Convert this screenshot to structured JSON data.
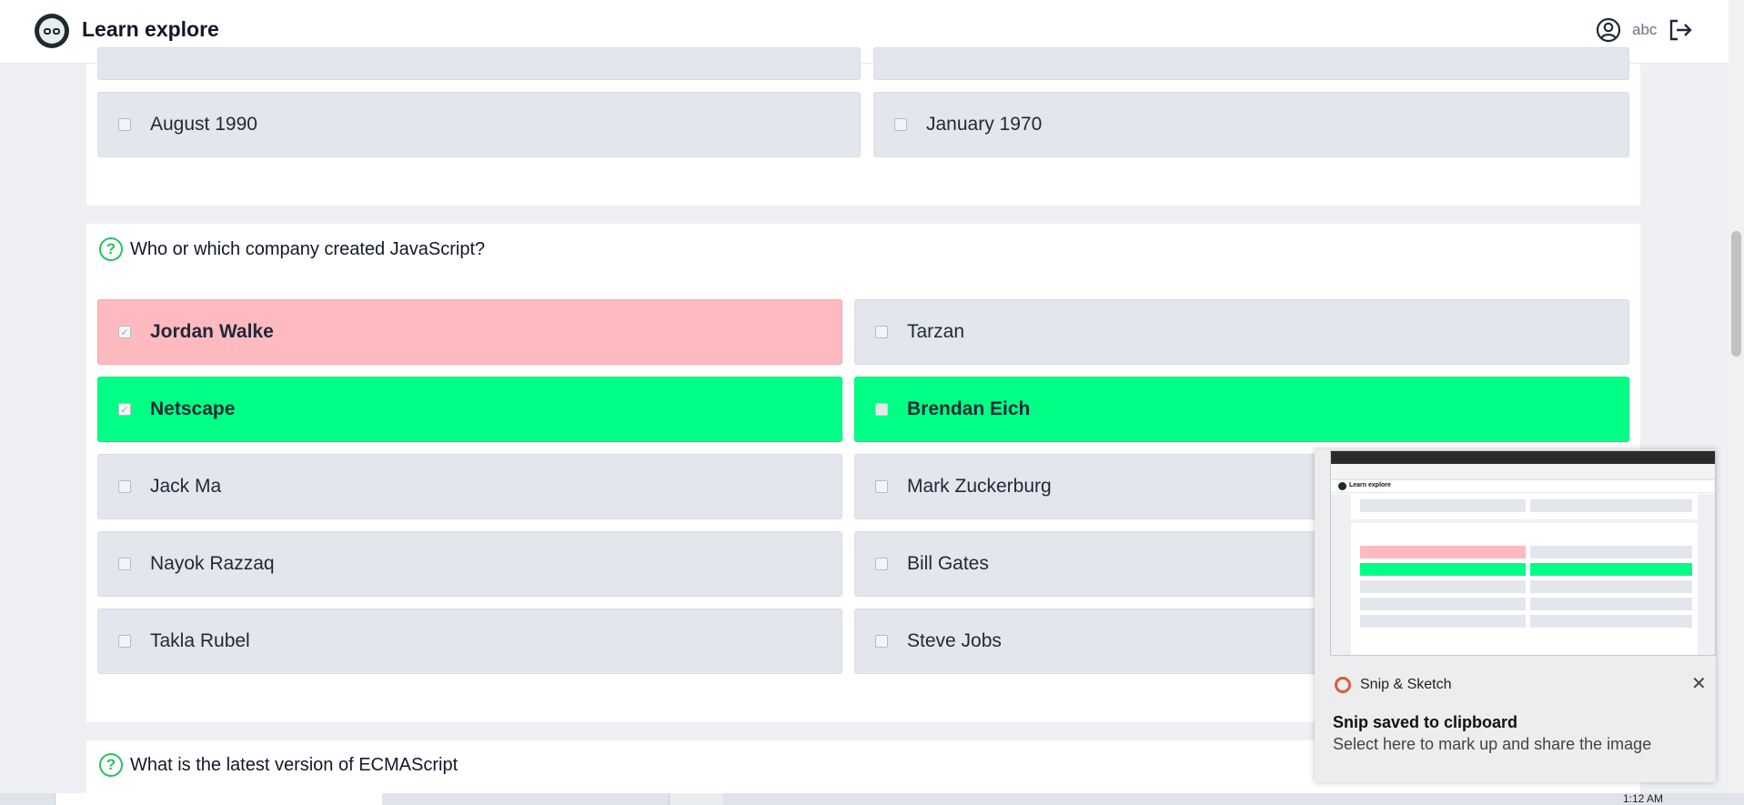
{
  "header": {
    "app_title": "Learn explore",
    "user_name": "abc"
  },
  "prev_question": {
    "options": [
      {
        "label": "August 1990",
        "state": "normal"
      },
      {
        "label": "January 1970",
        "state": "normal"
      }
    ]
  },
  "question": {
    "title": "Who or which company created JavaScript?",
    "options": [
      {
        "label": "Jordan Walke",
        "state": "wrong",
        "checked": true
      },
      {
        "label": "Tarzan",
        "state": "normal",
        "checked": false
      },
      {
        "label": "Netscape",
        "state": "correct",
        "checked": true
      },
      {
        "label": "Brendan Eich",
        "state": "correct",
        "checked": false
      },
      {
        "label": "Jack Ma",
        "state": "normal",
        "checked": false
      },
      {
        "label": "Mark Zuckerburg",
        "state": "normal",
        "checked": false
      },
      {
        "label": "Nayok Razzaq",
        "state": "normal",
        "checked": false
      },
      {
        "label": "Bill Gates",
        "state": "normal",
        "checked": false
      },
      {
        "label": "Takla Rubel",
        "state": "normal",
        "checked": false
      },
      {
        "label": "Steve Jobs",
        "state": "normal",
        "checked": false
      }
    ]
  },
  "next_question": {
    "title": "What is the latest version of ECMAScript"
  },
  "notification": {
    "app_name": "Snip & Sketch",
    "title": "Snip saved to clipboard",
    "body": "Select here to mark up and share the image"
  },
  "taskbar": {
    "time": "1:12 AM"
  },
  "colors": {
    "wrong": "#ffbac0",
    "correct": "#00ff85",
    "neutral": "#e3e6ec",
    "accent": "#22c55e"
  },
  "icons": {
    "logo": "owl-glasses-logo",
    "user": "user-circle-icon",
    "logout": "logout-icon",
    "question": "question-circle-icon"
  }
}
